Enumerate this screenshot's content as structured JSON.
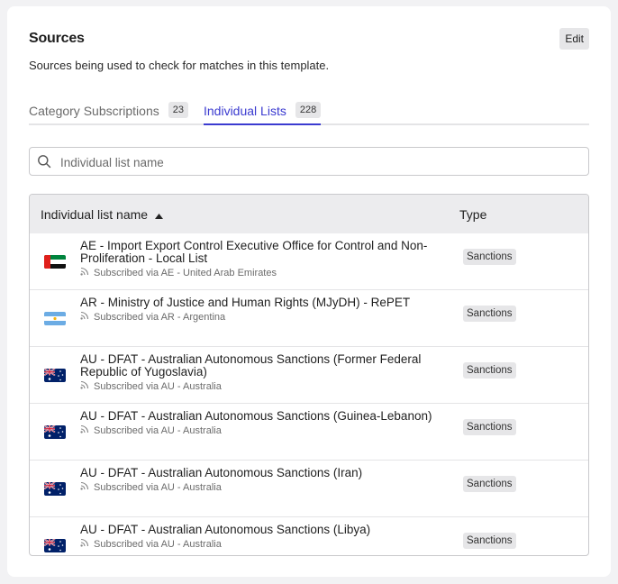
{
  "header": {
    "title": "Sources",
    "edit_label": "Edit",
    "subtitle": "Sources being used to check for matches in this template."
  },
  "tabs": [
    {
      "label": "Category Subscriptions",
      "count": "23",
      "active": false
    },
    {
      "label": "Individual Lists",
      "count": "228",
      "active": true
    }
  ],
  "search": {
    "placeholder": "Individual list name",
    "value": ""
  },
  "table": {
    "columns": {
      "name": "Individual list name",
      "type": "Type"
    },
    "sort": "ascending",
    "rows": [
      {
        "name": "AE - Import Export Control Executive Office for Control and Non-Proliferation - Local List",
        "subscribed": "Subscribed via AE - United Arab Emirates",
        "type": "Sanctions",
        "flag": "ae-flag-icon"
      },
      {
        "name": "AR - Ministry of Justice and Human Rights (MJyDH) - RePET",
        "subscribed": "Subscribed via AR - Argentina",
        "type": "Sanctions",
        "flag": "ar-flag-icon"
      },
      {
        "name": "AU - DFAT - Australian Autonomous Sanctions (Former Federal Republic of Yugoslavia)",
        "subscribed": "Subscribed via AU - Australia",
        "type": "Sanctions",
        "flag": "au-flag-icon"
      },
      {
        "name": "AU - DFAT - Australian Autonomous Sanctions (Guinea-Lebanon)",
        "subscribed": "Subscribed via AU - Australia",
        "type": "Sanctions",
        "flag": "au-flag-icon"
      },
      {
        "name": "AU - DFAT - Australian Autonomous Sanctions (Iran)",
        "subscribed": "Subscribed via AU - Australia",
        "type": "Sanctions",
        "flag": "au-flag-icon"
      },
      {
        "name": "AU - DFAT - Australian Autonomous Sanctions (Libya)",
        "subscribed": "Subscribed via AU - Australia",
        "type": "Sanctions",
        "flag": "au-flag-icon"
      }
    ]
  },
  "colors": {
    "accent": "#3b3bd0",
    "badge_bg": "#e6e6e8",
    "header_bg": "#ececee"
  }
}
